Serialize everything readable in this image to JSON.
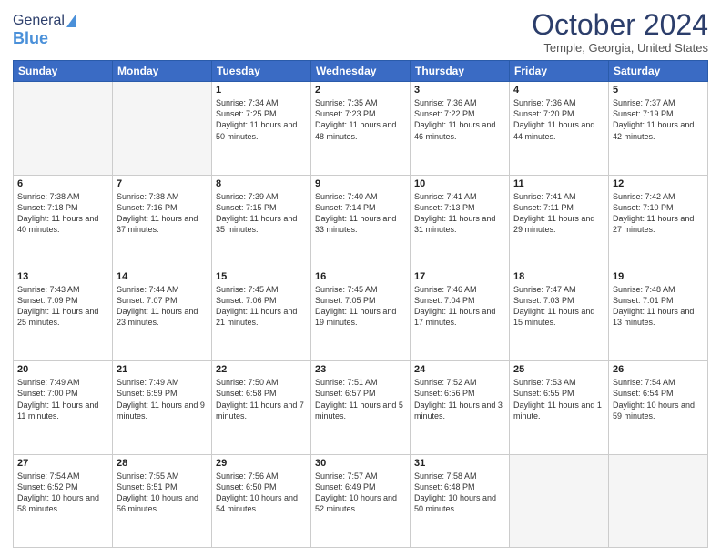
{
  "header": {
    "logo_general": "General",
    "logo_blue": "Blue",
    "month_title": "October 2024",
    "location": "Temple, Georgia, United States"
  },
  "days_of_week": [
    "Sunday",
    "Monday",
    "Tuesday",
    "Wednesday",
    "Thursday",
    "Friday",
    "Saturday"
  ],
  "weeks": [
    [
      {
        "day": "",
        "empty": true
      },
      {
        "day": "",
        "empty": true
      },
      {
        "day": "1",
        "sunrise": "Sunrise: 7:34 AM",
        "sunset": "Sunset: 7:25 PM",
        "daylight": "Daylight: 11 hours and 50 minutes."
      },
      {
        "day": "2",
        "sunrise": "Sunrise: 7:35 AM",
        "sunset": "Sunset: 7:23 PM",
        "daylight": "Daylight: 11 hours and 48 minutes."
      },
      {
        "day": "3",
        "sunrise": "Sunrise: 7:36 AM",
        "sunset": "Sunset: 7:22 PM",
        "daylight": "Daylight: 11 hours and 46 minutes."
      },
      {
        "day": "4",
        "sunrise": "Sunrise: 7:36 AM",
        "sunset": "Sunset: 7:20 PM",
        "daylight": "Daylight: 11 hours and 44 minutes."
      },
      {
        "day": "5",
        "sunrise": "Sunrise: 7:37 AM",
        "sunset": "Sunset: 7:19 PM",
        "daylight": "Daylight: 11 hours and 42 minutes."
      }
    ],
    [
      {
        "day": "6",
        "sunrise": "Sunrise: 7:38 AM",
        "sunset": "Sunset: 7:18 PM",
        "daylight": "Daylight: 11 hours and 40 minutes."
      },
      {
        "day": "7",
        "sunrise": "Sunrise: 7:38 AM",
        "sunset": "Sunset: 7:16 PM",
        "daylight": "Daylight: 11 hours and 37 minutes."
      },
      {
        "day": "8",
        "sunrise": "Sunrise: 7:39 AM",
        "sunset": "Sunset: 7:15 PM",
        "daylight": "Daylight: 11 hours and 35 minutes."
      },
      {
        "day": "9",
        "sunrise": "Sunrise: 7:40 AM",
        "sunset": "Sunset: 7:14 PM",
        "daylight": "Daylight: 11 hours and 33 minutes."
      },
      {
        "day": "10",
        "sunrise": "Sunrise: 7:41 AM",
        "sunset": "Sunset: 7:13 PM",
        "daylight": "Daylight: 11 hours and 31 minutes."
      },
      {
        "day": "11",
        "sunrise": "Sunrise: 7:41 AM",
        "sunset": "Sunset: 7:11 PM",
        "daylight": "Daylight: 11 hours and 29 minutes."
      },
      {
        "day": "12",
        "sunrise": "Sunrise: 7:42 AM",
        "sunset": "Sunset: 7:10 PM",
        "daylight": "Daylight: 11 hours and 27 minutes."
      }
    ],
    [
      {
        "day": "13",
        "sunrise": "Sunrise: 7:43 AM",
        "sunset": "Sunset: 7:09 PM",
        "daylight": "Daylight: 11 hours and 25 minutes."
      },
      {
        "day": "14",
        "sunrise": "Sunrise: 7:44 AM",
        "sunset": "Sunset: 7:07 PM",
        "daylight": "Daylight: 11 hours and 23 minutes."
      },
      {
        "day": "15",
        "sunrise": "Sunrise: 7:45 AM",
        "sunset": "Sunset: 7:06 PM",
        "daylight": "Daylight: 11 hours and 21 minutes."
      },
      {
        "day": "16",
        "sunrise": "Sunrise: 7:45 AM",
        "sunset": "Sunset: 7:05 PM",
        "daylight": "Daylight: 11 hours and 19 minutes."
      },
      {
        "day": "17",
        "sunrise": "Sunrise: 7:46 AM",
        "sunset": "Sunset: 7:04 PM",
        "daylight": "Daylight: 11 hours and 17 minutes."
      },
      {
        "day": "18",
        "sunrise": "Sunrise: 7:47 AM",
        "sunset": "Sunset: 7:03 PM",
        "daylight": "Daylight: 11 hours and 15 minutes."
      },
      {
        "day": "19",
        "sunrise": "Sunrise: 7:48 AM",
        "sunset": "Sunset: 7:01 PM",
        "daylight": "Daylight: 11 hours and 13 minutes."
      }
    ],
    [
      {
        "day": "20",
        "sunrise": "Sunrise: 7:49 AM",
        "sunset": "Sunset: 7:00 PM",
        "daylight": "Daylight: 11 hours and 11 minutes."
      },
      {
        "day": "21",
        "sunrise": "Sunrise: 7:49 AM",
        "sunset": "Sunset: 6:59 PM",
        "daylight": "Daylight: 11 hours and 9 minutes."
      },
      {
        "day": "22",
        "sunrise": "Sunrise: 7:50 AM",
        "sunset": "Sunset: 6:58 PM",
        "daylight": "Daylight: 11 hours and 7 minutes."
      },
      {
        "day": "23",
        "sunrise": "Sunrise: 7:51 AM",
        "sunset": "Sunset: 6:57 PM",
        "daylight": "Daylight: 11 hours and 5 minutes."
      },
      {
        "day": "24",
        "sunrise": "Sunrise: 7:52 AM",
        "sunset": "Sunset: 6:56 PM",
        "daylight": "Daylight: 11 hours and 3 minutes."
      },
      {
        "day": "25",
        "sunrise": "Sunrise: 7:53 AM",
        "sunset": "Sunset: 6:55 PM",
        "daylight": "Daylight: 11 hours and 1 minute."
      },
      {
        "day": "26",
        "sunrise": "Sunrise: 7:54 AM",
        "sunset": "Sunset: 6:54 PM",
        "daylight": "Daylight: 10 hours and 59 minutes."
      }
    ],
    [
      {
        "day": "27",
        "sunrise": "Sunrise: 7:54 AM",
        "sunset": "Sunset: 6:52 PM",
        "daylight": "Daylight: 10 hours and 58 minutes."
      },
      {
        "day": "28",
        "sunrise": "Sunrise: 7:55 AM",
        "sunset": "Sunset: 6:51 PM",
        "daylight": "Daylight: 10 hours and 56 minutes."
      },
      {
        "day": "29",
        "sunrise": "Sunrise: 7:56 AM",
        "sunset": "Sunset: 6:50 PM",
        "daylight": "Daylight: 10 hours and 54 minutes."
      },
      {
        "day": "30",
        "sunrise": "Sunrise: 7:57 AM",
        "sunset": "Sunset: 6:49 PM",
        "daylight": "Daylight: 10 hours and 52 minutes."
      },
      {
        "day": "31",
        "sunrise": "Sunrise: 7:58 AM",
        "sunset": "Sunset: 6:48 PM",
        "daylight": "Daylight: 10 hours and 50 minutes."
      },
      {
        "day": "",
        "empty": true
      },
      {
        "day": "",
        "empty": true
      }
    ]
  ]
}
